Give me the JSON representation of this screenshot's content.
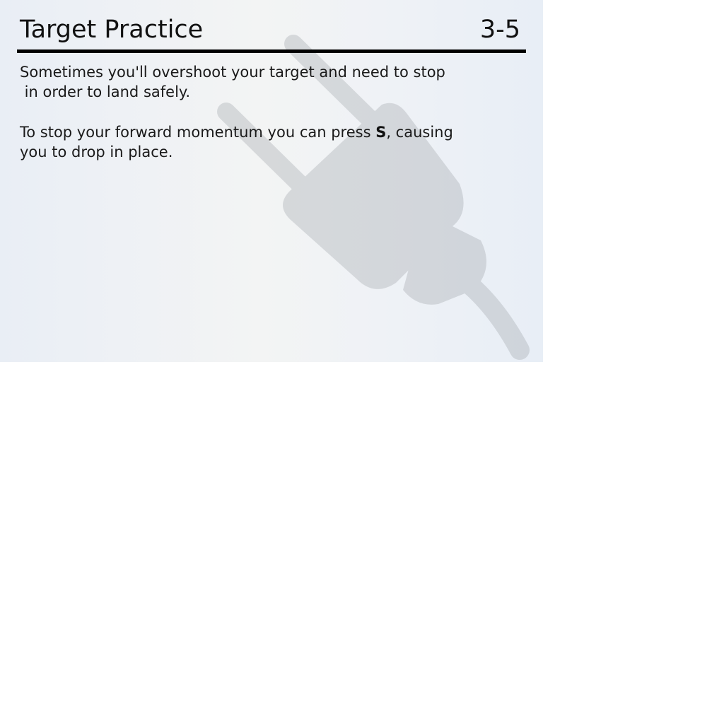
{
  "header": {
    "title": "Target Practice",
    "level": "3-5"
  },
  "instructions": {
    "para1_line1": "Sometimes you'll overshoot your target and need to stop",
    "para1_line2": " in order to land safely.",
    "para2_line1_before": "To stop your forward momentum you can press ",
    "para2_key": "S",
    "para2_line1_after": ", causing",
    "para2_line2": "you to drop in place."
  },
  "background": {
    "watermark": "plug-icon",
    "watermark_color": "#9aa0a6"
  }
}
